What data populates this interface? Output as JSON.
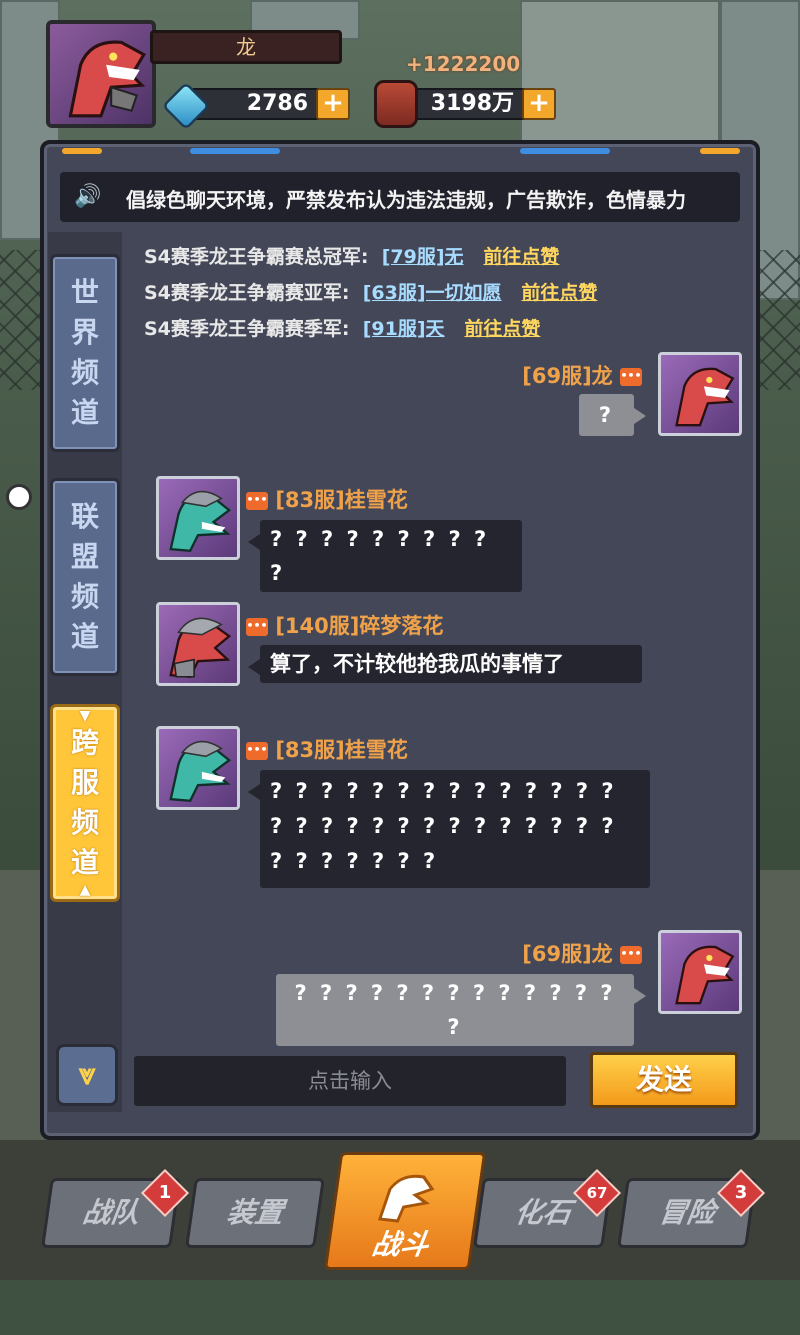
{
  "player": {
    "name": "龙",
    "gems": "2786",
    "cash": "3198万",
    "cash_delta": "+1222200"
  },
  "notice": {
    "text": "倡绿色聊天环境，严禁发布认为违法违规，广告欺诈，色情暴力"
  },
  "tabs": [
    {
      "label": [
        "世",
        "界",
        "频",
        "道"
      ],
      "active": false
    },
    {
      "label": [
        "联",
        "盟",
        "频",
        "道"
      ],
      "active": false
    },
    {
      "label": [
        "跨",
        "服",
        "频",
        "道"
      ],
      "active": true
    }
  ],
  "system_messages": [
    {
      "text": "S4赛季龙王争霸赛总冠军:",
      "server": "[79服]无",
      "action": "前往点赞"
    },
    {
      "text": "S4赛季龙王争霸赛亚军:",
      "server": "[63服]一切如愿",
      "action": "前往点赞"
    },
    {
      "text": "S4赛季龙王争霸赛季军:",
      "server": "[91服]天",
      "action": "前往点赞"
    }
  ],
  "messages": [
    {
      "user": "[69服]龙",
      "text": "?",
      "mine": true
    },
    {
      "user": "[83服]桂雪花",
      "text": "? ? ? ? ? ? ? ? ? ?",
      "mine": false
    },
    {
      "user": "[140服]碎梦落花",
      "text": "算了，不计较他抢我瓜的事情了",
      "mine": false
    },
    {
      "user": "[83服]桂雪花",
      "text": "? ? ? ? ? ? ? ? ? ? ? ? ? ? ? ? ? ? ? ? ? ? ? ? ? ? ? ? ? ? ? ? ? ? ?",
      "mine": false
    },
    {
      "user": "[69服]龙",
      "text": "? ? ? ? ? ? ? ? ? ? ? ? ? ?",
      "mine": true
    }
  ],
  "input": {
    "placeholder": "点击输入",
    "send_label": "发送"
  },
  "nav": [
    {
      "label": "战队",
      "badge": "1"
    },
    {
      "label": "装置",
      "badge": ""
    },
    {
      "label": "战斗",
      "badge": ""
    },
    {
      "label": "化石",
      "badge": "67"
    },
    {
      "label": "冒险",
      "badge": "3"
    }
  ],
  "colors": {
    "accent": "#ffc63a",
    "username": "#f0a24a",
    "link": "#a8dcff",
    "action": "#ffd75e"
  }
}
